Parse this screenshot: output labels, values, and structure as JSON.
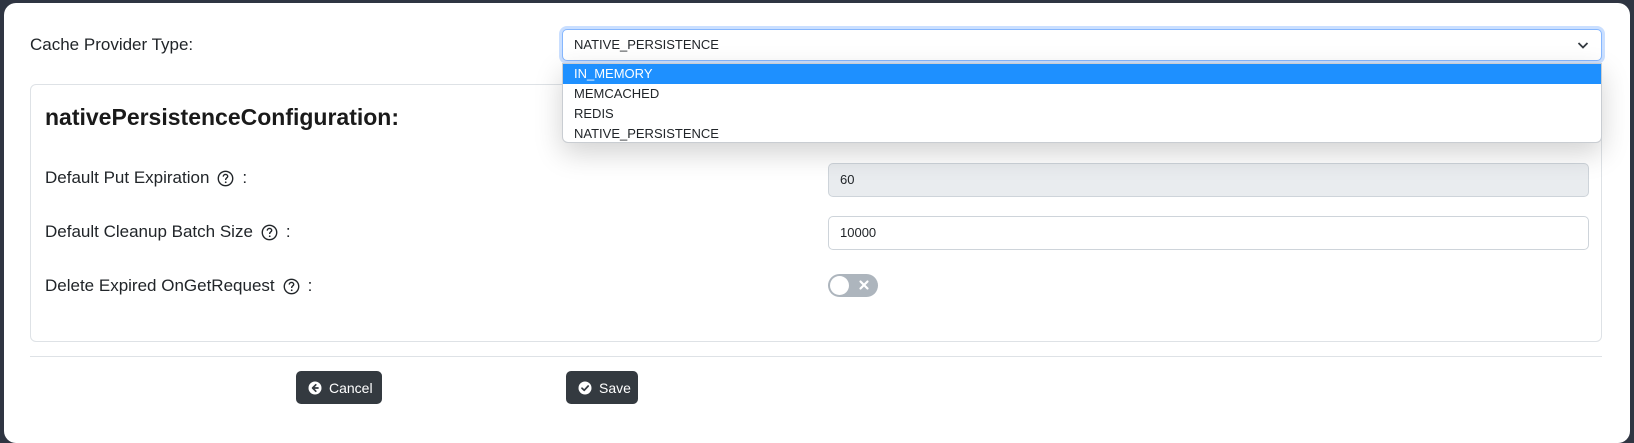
{
  "cache_provider": {
    "label": "Cache Provider Type:",
    "selected": "NATIVE_PERSISTENCE",
    "options": [
      "IN_MEMORY",
      "MEMCACHED",
      "REDIS",
      "NATIVE_PERSISTENCE"
    ],
    "highlighted_option": "IN_MEMORY"
  },
  "config": {
    "title": "nativePersistenceConfiguration:",
    "fields": [
      {
        "label": "Default Put Expiration",
        "value": "60",
        "disabled": true
      },
      {
        "label": "Default Cleanup Batch Size",
        "value": "10000",
        "disabled": false
      },
      {
        "label": "Delete Expired OnGetRequest",
        "toggle": false
      }
    ],
    "colon": ":"
  },
  "actions": {
    "cancel_label": "Cancel",
    "save_label": "Save"
  },
  "icons": {
    "help": "question-circle-icon",
    "chevron": "chevron-down-icon",
    "cancel": "arrow-left-circle-icon",
    "save": "check-circle-icon",
    "toggle_off": "x-icon"
  },
  "colors": {
    "highlight": "#1e90ff",
    "button": "#343a40",
    "toggle_off": "#adb5bd"
  }
}
